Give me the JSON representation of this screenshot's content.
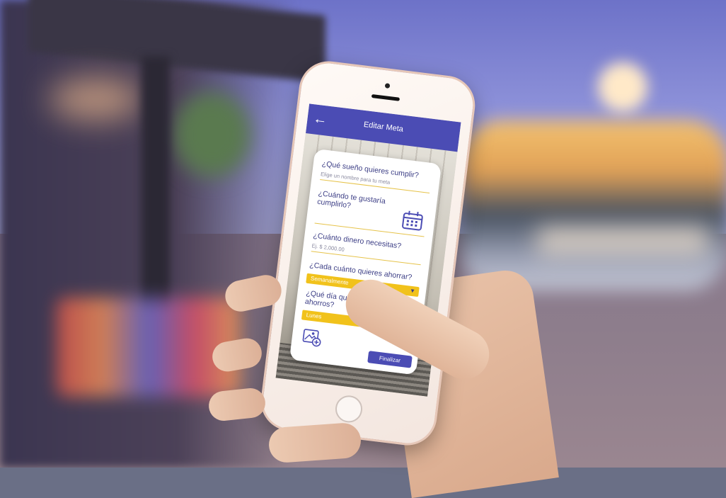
{
  "app": {
    "title": "Editar Meta",
    "back_icon": "arrow-left-icon",
    "accent": "#4b4cb4",
    "highlight": "#f1c21b"
  },
  "form": {
    "dream": {
      "question": "¿Qué sueño quieres cumplir?",
      "placeholder": "Elige un nombre para tu meta"
    },
    "date": {
      "question_line1": "¿Cuándo te gustaría",
      "question_line2": "cumplirlo?",
      "icon": "calendar-icon"
    },
    "amount": {
      "question": "¿Cuánto dinero necesitas?",
      "placeholder": "Ej. $ 2,000.00"
    },
    "frequency": {
      "question": "¿Cada cuánto quieres ahorrar?",
      "selected": "Semanalmente",
      "icon": "caret-down-icon"
    },
    "day": {
      "question_line1": "¿Qué día quieres registrar tus",
      "question_line2": "ahorros?",
      "selected": "Lunes"
    },
    "image_icon": "add-image-icon",
    "finish_label": "Finalizar"
  }
}
